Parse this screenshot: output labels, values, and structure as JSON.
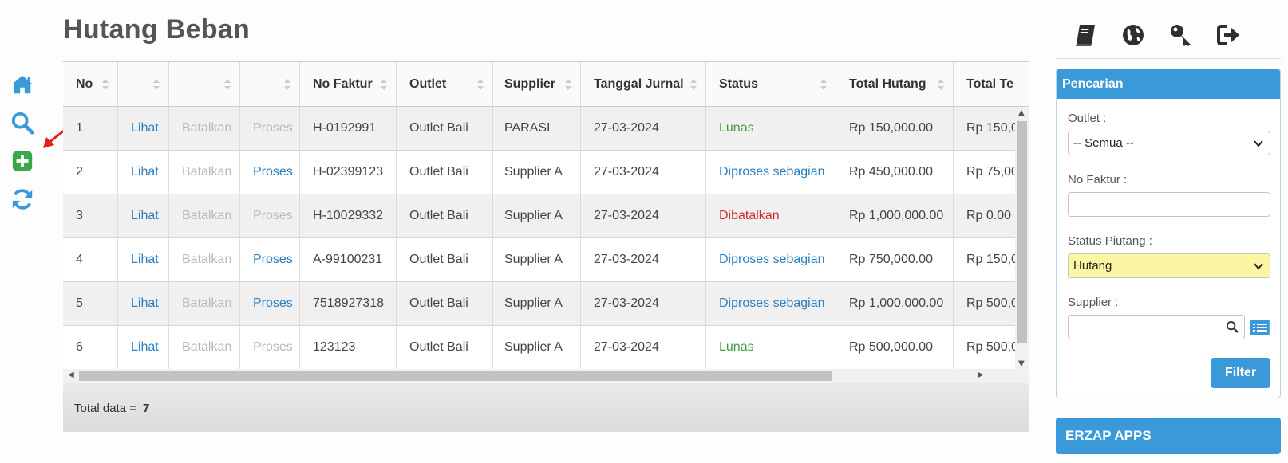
{
  "title": "Hutang Beban",
  "rail": [
    "home-icon",
    "search-icon",
    "plus-square-icon",
    "refresh-icon"
  ],
  "colors": {
    "accent": "#3a99d8",
    "link": "#2a7fc1",
    "green": "#3f9a3f",
    "red": "#c9302c",
    "plus": "#3aa84a",
    "highlight": "#fcf6a3"
  },
  "table": {
    "columns": [
      "No",
      "",
      "",
      "",
      "No Faktur",
      "Outlet",
      "Supplier",
      "Tanggal Jurnal",
      "Status",
      "Total Hutang",
      "Total Te"
    ],
    "rows": [
      {
        "no": "1",
        "lihat": "Lihat",
        "batalkan": "Batalkan",
        "proses": "Proses",
        "proses_active": false,
        "faktur": "H-0192991",
        "outlet": "Outlet Bali",
        "supplier": "PARASI",
        "tanggal": "27-03-2024",
        "status": "Lunas",
        "status_color": "green",
        "total": "Rp 150,000.00",
        "total_te": "Rp 150,0"
      },
      {
        "no": "2",
        "lihat": "Lihat",
        "batalkan": "Batalkan",
        "proses": "Proses",
        "proses_active": true,
        "faktur": "H-02399123",
        "outlet": "Outlet Bali",
        "supplier": "Supplier A",
        "tanggal": "27-03-2024",
        "status": "Diproses sebagian",
        "status_color": "blue",
        "total": "Rp 450,000.00",
        "total_te": "Rp 75,00"
      },
      {
        "no": "3",
        "lihat": "Lihat",
        "batalkan": "Batalkan",
        "proses": "Proses",
        "proses_active": false,
        "faktur": "H-10029332",
        "outlet": "Outlet Bali",
        "supplier": "Supplier A",
        "tanggal": "27-03-2024",
        "status": "Dibatalkan",
        "status_color": "red",
        "total": "Rp 1,000,000.00",
        "total_te": "Rp 0.00"
      },
      {
        "no": "4",
        "lihat": "Lihat",
        "batalkan": "Batalkan",
        "proses": "Proses",
        "proses_active": true,
        "faktur": "A-99100231",
        "outlet": "Outlet Bali",
        "supplier": "Supplier A",
        "tanggal": "27-03-2024",
        "status": "Diproses sebagian",
        "status_color": "blue",
        "total": "Rp 750,000.00",
        "total_te": "Rp 150,0"
      },
      {
        "no": "5",
        "lihat": "Lihat",
        "batalkan": "Batalkan",
        "proses": "Proses",
        "proses_active": true,
        "faktur": "7518927318",
        "outlet": "Outlet Bali",
        "supplier": "Supplier A",
        "tanggal": "27-03-2024",
        "status": "Diproses sebagian",
        "status_color": "blue",
        "total": "Rp 1,000,000.00",
        "total_te": "Rp 500,0"
      },
      {
        "no": "6",
        "lihat": "Lihat",
        "batalkan": "Batalkan",
        "proses": "Proses",
        "proses_active": false,
        "faktur": "123123",
        "outlet": "Outlet Bali",
        "supplier": "Supplier A",
        "tanggal": "27-03-2024",
        "status": "Lunas",
        "status_color": "green",
        "total": "Rp 500,000.00",
        "total_te": "Rp 500,0"
      }
    ],
    "footer_label": "Total data =",
    "footer_count": "7"
  },
  "top_icons": [
    "book-icon",
    "globe-icon",
    "key-icon",
    "logout-icon"
  ],
  "search": {
    "title": "Pencarian",
    "outlet_label": "Outlet :",
    "outlet_value": "-- Semua --",
    "faktur_label": "No Faktur :",
    "faktur_value": "",
    "status_label": "Status Piutang :",
    "status_value": "Hutang",
    "supplier_label": "Supplier :",
    "supplier_value": "",
    "filter_label": "Filter"
  },
  "apps_label": "ERZAP APPS"
}
